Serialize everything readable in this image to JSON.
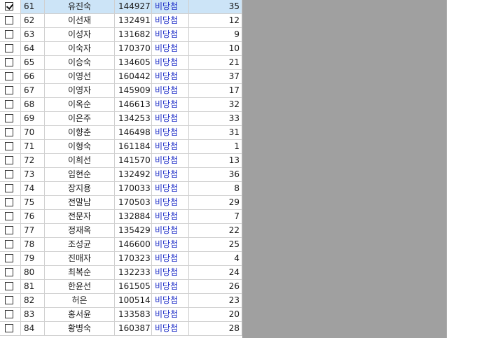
{
  "colors": {
    "gray_area": "#a0a0a0",
    "selected_row": "#cce4f7",
    "status_text": "#1f2fc8",
    "grid_line": "#d0d0d0"
  },
  "rows": [
    {
      "checked": true,
      "no": "61",
      "name": "유진숙",
      "id": "144927",
      "status": "비당첨",
      "value": "35"
    },
    {
      "checked": false,
      "no": "62",
      "name": "이선재",
      "id": "132491",
      "status": "비당첨",
      "value": "12"
    },
    {
      "checked": false,
      "no": "63",
      "name": "이성자",
      "id": "131682",
      "status": "비당첨",
      "value": "9"
    },
    {
      "checked": false,
      "no": "64",
      "name": "이숙자",
      "id": "170370",
      "status": "비당첨",
      "value": "10"
    },
    {
      "checked": false,
      "no": "65",
      "name": "이승숙",
      "id": "134605",
      "status": "비당첨",
      "value": "21"
    },
    {
      "checked": false,
      "no": "66",
      "name": "이영선",
      "id": "160442",
      "status": "비당첨",
      "value": "37"
    },
    {
      "checked": false,
      "no": "67",
      "name": "이영자",
      "id": "145909",
      "status": "비당첨",
      "value": "17"
    },
    {
      "checked": false,
      "no": "68",
      "name": "이옥순",
      "id": "146613",
      "status": "비당첨",
      "value": "32"
    },
    {
      "checked": false,
      "no": "69",
      "name": "이은주",
      "id": "134253",
      "status": "비당첨",
      "value": "33"
    },
    {
      "checked": false,
      "no": "70",
      "name": "이향춘",
      "id": "146498",
      "status": "비당첨",
      "value": "31"
    },
    {
      "checked": false,
      "no": "71",
      "name": "이형숙",
      "id": "161184",
      "status": "비당첨",
      "value": "1"
    },
    {
      "checked": false,
      "no": "72",
      "name": "이희선",
      "id": "141570",
      "status": "비당첨",
      "value": "13"
    },
    {
      "checked": false,
      "no": "73",
      "name": "임현순",
      "id": "132492",
      "status": "비당첨",
      "value": "36"
    },
    {
      "checked": false,
      "no": "74",
      "name": "장지용",
      "id": "170033",
      "status": "비당첨",
      "value": "8"
    },
    {
      "checked": false,
      "no": "75",
      "name": "전말남",
      "id": "170503",
      "status": "비당첨",
      "value": "29"
    },
    {
      "checked": false,
      "no": "76",
      "name": "전문자",
      "id": "132884",
      "status": "비당첨",
      "value": "7"
    },
    {
      "checked": false,
      "no": "77",
      "name": "정재옥",
      "id": "135429",
      "status": "비당첨",
      "value": "22"
    },
    {
      "checked": false,
      "no": "78",
      "name": "조성균",
      "id": "146600",
      "status": "비당첨",
      "value": "25"
    },
    {
      "checked": false,
      "no": "79",
      "name": "진매자",
      "id": "170323",
      "status": "비당첨",
      "value": "4"
    },
    {
      "checked": false,
      "no": "80",
      "name": "최복순",
      "id": "132233",
      "status": "비당첨",
      "value": "24"
    },
    {
      "checked": false,
      "no": "81",
      "name": "한윤선",
      "id": "161505",
      "status": "비당첨",
      "value": "26"
    },
    {
      "checked": false,
      "no": "82",
      "name": "허은",
      "id": "100514",
      "status": "비당첨",
      "value": "23"
    },
    {
      "checked": false,
      "no": "83",
      "name": "홍서윤",
      "id": "133583",
      "status": "비당첨",
      "value": "20"
    },
    {
      "checked": false,
      "no": "84",
      "name": "황병숙",
      "id": "160387",
      "status": "비당첨",
      "value": "28"
    }
  ]
}
